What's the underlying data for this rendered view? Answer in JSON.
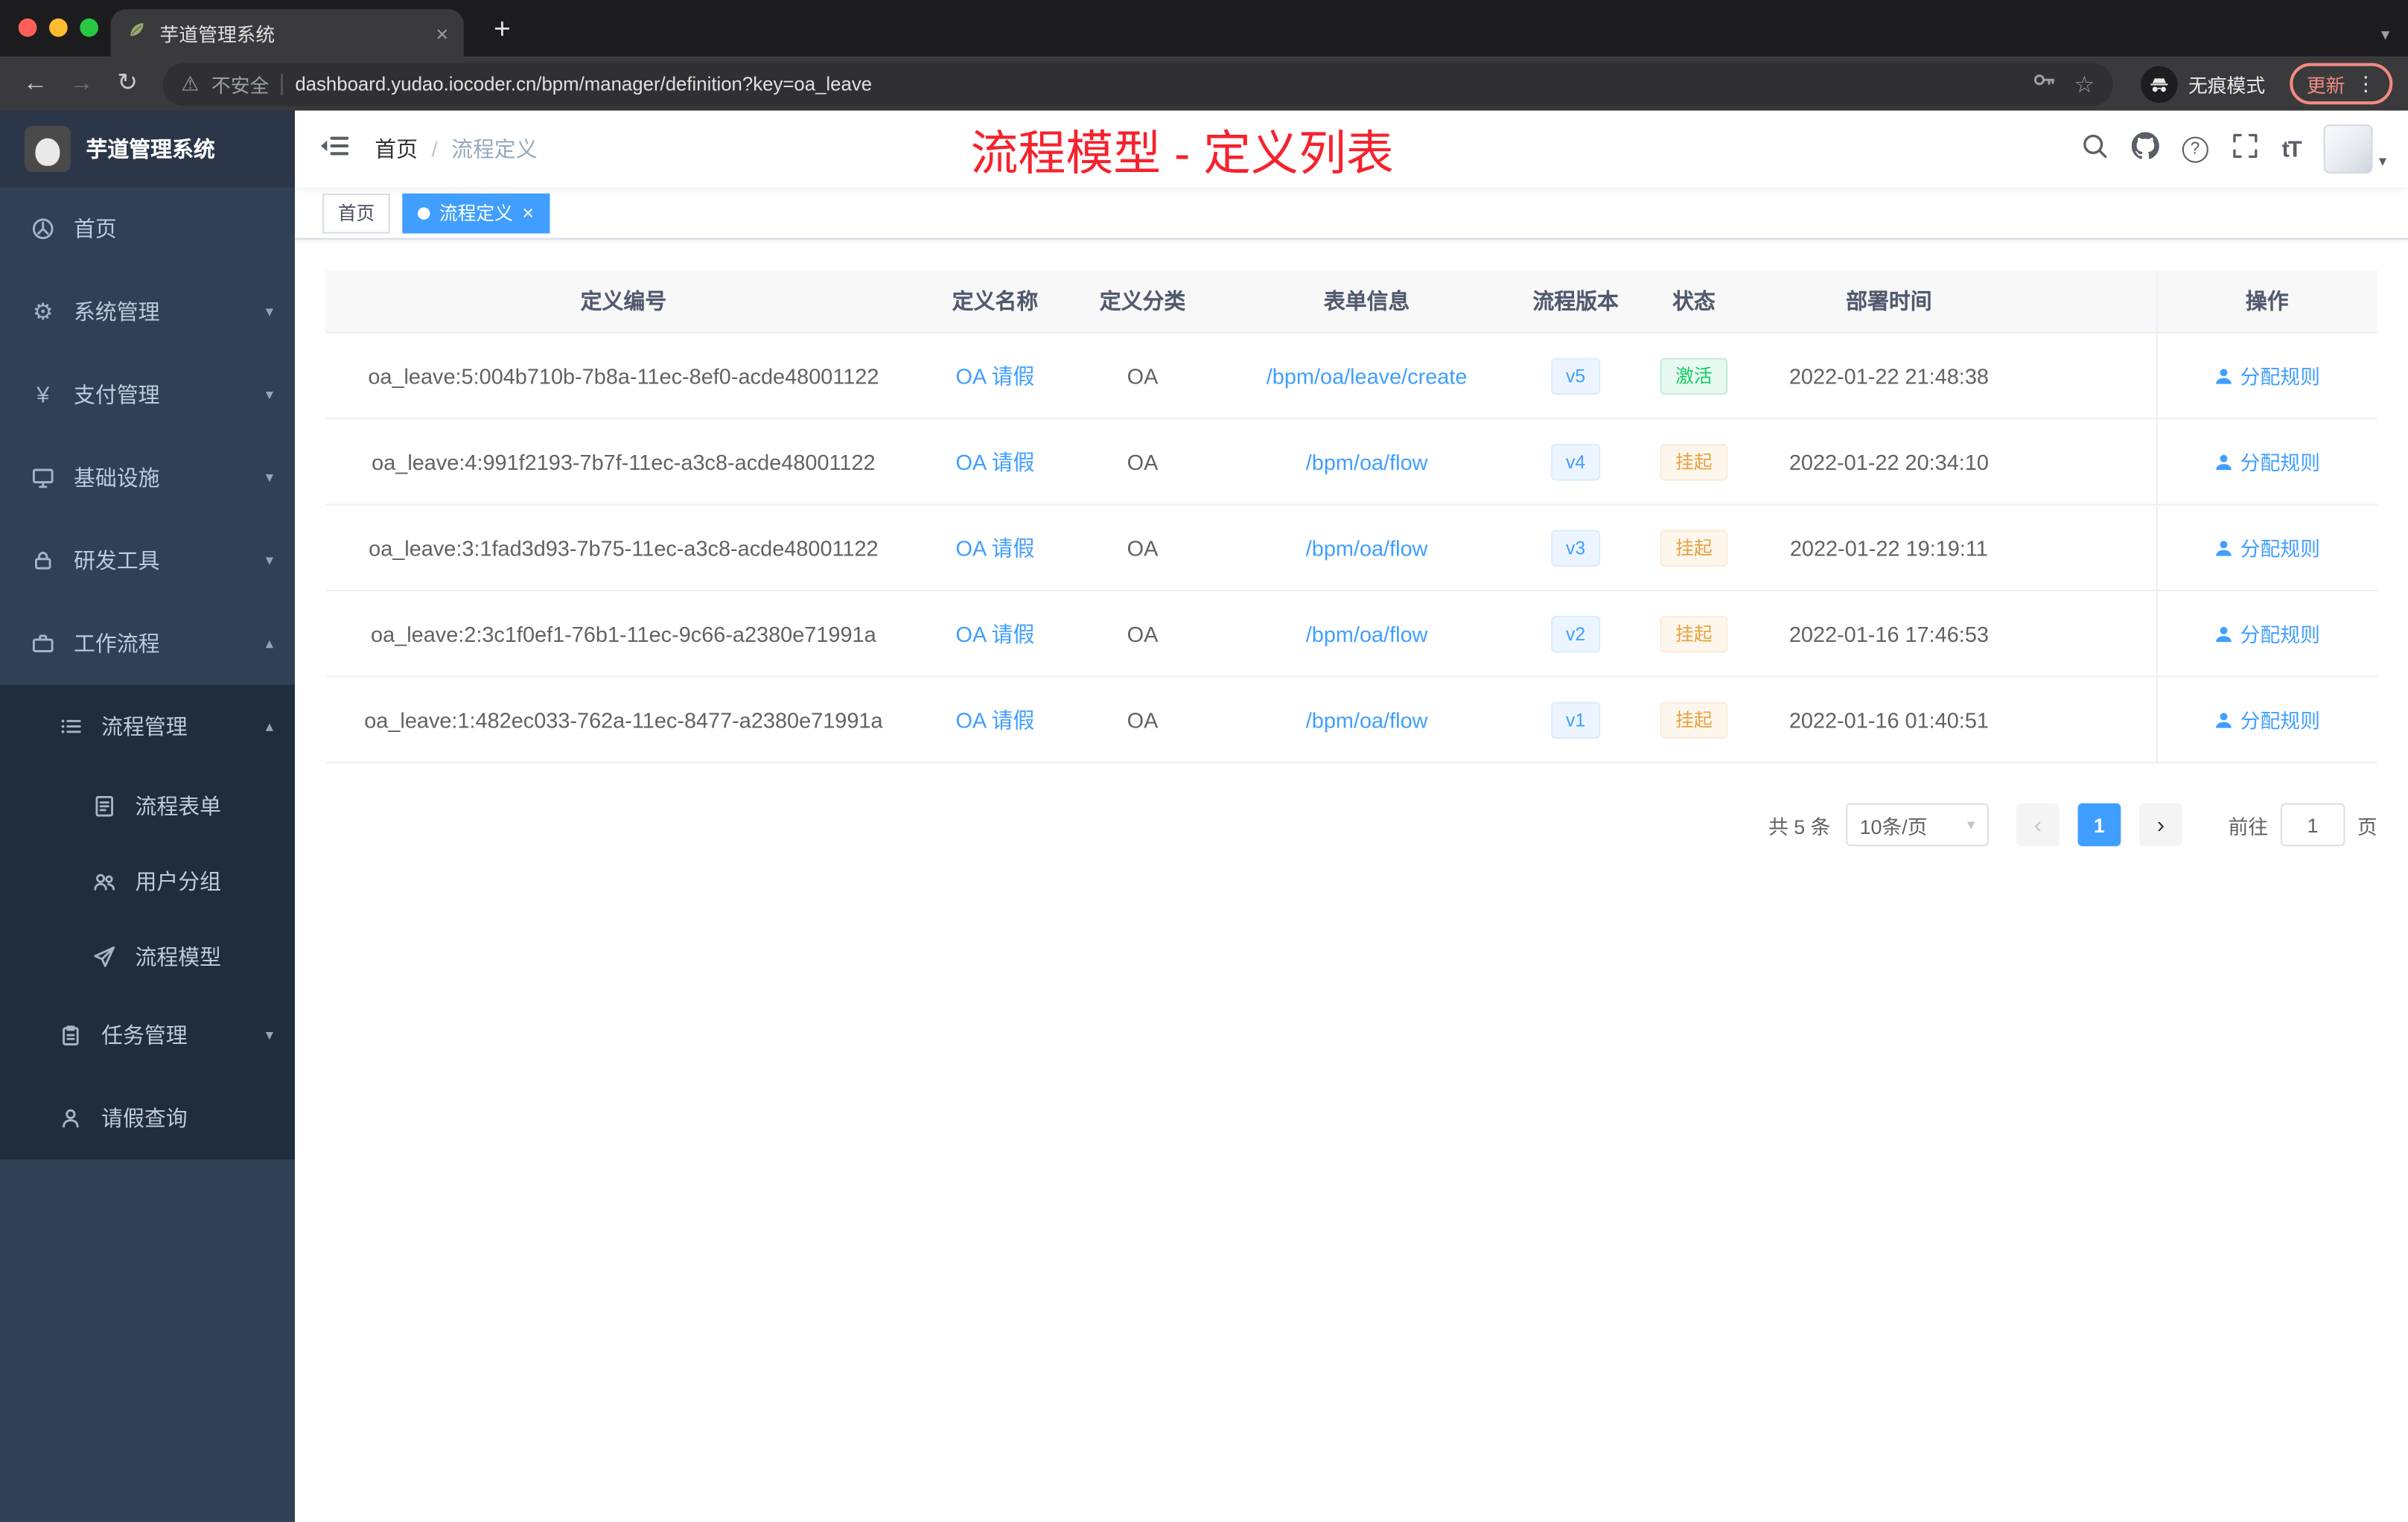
{
  "browser": {
    "tab_title": "芋道管理系统",
    "security_label": "不安全",
    "url": "dashboard.yudao.iocoder.cn/bpm/manager/definition?key=oa_leave",
    "incognito_label": "无痕模式",
    "update_label": "更新"
  },
  "icons": {
    "gear": "⚙",
    "yen": "¥",
    "chevron_down": "▾",
    "chevron_up": "▴",
    "close": "×",
    "plus": "+",
    "kebab": "⋮",
    "caret_down": "▾",
    "back": "←",
    "forward": "→",
    "reload": "↻",
    "warning": "⚠",
    "star": "☆",
    "question": "?",
    "font_size": "tT",
    "prev": "‹",
    "next": "›"
  },
  "sidebar": {
    "logo_title": "芋道管理系统",
    "items": [
      {
        "label": "首页"
      },
      {
        "label": "系统管理"
      },
      {
        "label": "支付管理"
      },
      {
        "label": "基础设施"
      },
      {
        "label": "研发工具"
      },
      {
        "label": "工作流程"
      },
      {
        "label": "流程管理"
      },
      {
        "label": "流程表单"
      },
      {
        "label": "用户分组"
      },
      {
        "label": "流程模型"
      },
      {
        "label": "任务管理"
      },
      {
        "label": "请假查询"
      }
    ]
  },
  "header": {
    "breadcrumb": {
      "home": "首页",
      "separator": "/",
      "current": "流程定义"
    },
    "annotation": "流程模型 - 定义列表"
  },
  "tags": {
    "home": "首页",
    "active": "流程定义"
  },
  "table": {
    "columns": [
      "定义编号",
      "定义名称",
      "定义分类",
      "表单信息",
      "流程版本",
      "状态",
      "部署时间",
      "操作"
    ],
    "action_label": "分配规则",
    "rows": [
      {
        "id": "oa_leave:5:004b710b-7b8a-11ec-8ef0-acde48001122",
        "name": "OA 请假",
        "category": "OA",
        "form": "/bpm/oa/leave/create",
        "version": "v5",
        "status": "激活",
        "status_class": "success",
        "time": "2022-01-22 21:48:38"
      },
      {
        "id": "oa_leave:4:991f2193-7b7f-11ec-a3c8-acde48001122",
        "name": "OA 请假",
        "category": "OA",
        "form": "/bpm/oa/flow",
        "version": "v4",
        "status": "挂起",
        "status_class": "warning",
        "time": "2022-01-22 20:34:10"
      },
      {
        "id": "oa_leave:3:1fad3d93-7b75-11ec-a3c8-acde48001122",
        "name": "OA 请假",
        "category": "OA",
        "form": "/bpm/oa/flow",
        "version": "v3",
        "status": "挂起",
        "status_class": "warning",
        "time": "2022-01-22 19:19:11"
      },
      {
        "id": "oa_leave:2:3c1f0ef1-76b1-11ec-9c66-a2380e71991a",
        "name": "OA 请假",
        "category": "OA",
        "form": "/bpm/oa/flow",
        "version": "v2",
        "status": "挂起",
        "status_class": "warning",
        "time": "2022-01-16 17:46:53"
      },
      {
        "id": "oa_leave:1:482ec033-762a-11ec-8477-a2380e71991a",
        "name": "OA 请假",
        "category": "OA",
        "form": "/bpm/oa/flow",
        "version": "v1",
        "status": "挂起",
        "status_class": "warning",
        "time": "2022-01-16 01:40:51"
      }
    ]
  },
  "pagination": {
    "total": "共 5 条",
    "page_size": "10条/页",
    "page": "1",
    "goto_label": "前往",
    "goto_value": "1",
    "page_unit": "页"
  },
  "colors": {
    "accent": "#409eff",
    "annotation_red": "#f5222d",
    "success": "#13ce66",
    "warning": "#e6a23c"
  }
}
